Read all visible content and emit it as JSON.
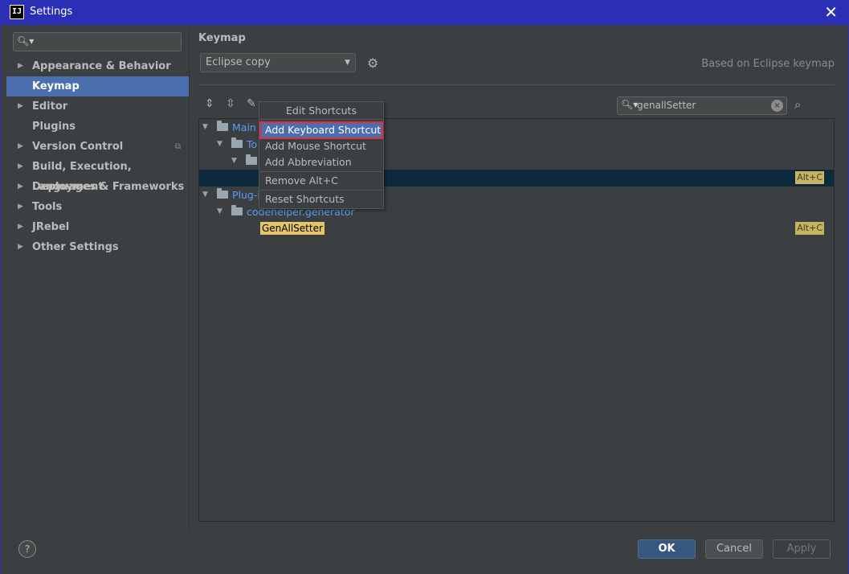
{
  "window": {
    "title": "Settings",
    "app_icon_text": "IJ",
    "close_glyph": "✕"
  },
  "sidebar": {
    "search_placeholder": "",
    "items": [
      {
        "label": "Appearance & Behavior",
        "has_arrow": true
      },
      {
        "label": "Keymap",
        "has_arrow": false,
        "selected": true
      },
      {
        "label": "Editor",
        "has_arrow": true
      },
      {
        "label": "Plugins",
        "has_arrow": false
      },
      {
        "label": "Version Control",
        "has_arrow": true,
        "badge": "copy-icon"
      },
      {
        "label": "Build, Execution, Deployment",
        "has_arrow": true
      },
      {
        "label": "Languages & Frameworks",
        "has_arrow": true
      },
      {
        "label": "Tools",
        "has_arrow": true
      },
      {
        "label": "JRebel",
        "has_arrow": true
      },
      {
        "label": "Other Settings",
        "has_arrow": true
      }
    ]
  },
  "content": {
    "heading": "Keymap",
    "keymap_combo_value": "Eclipse copy",
    "based_on": "Based on Eclipse keymap",
    "search_value": "genallSetter"
  },
  "tree": {
    "rows": [
      {
        "label": "Main",
        "level": 0
      },
      {
        "label": "To",
        "level": 1
      },
      {
        "label": "",
        "level": 2
      },
      {
        "label": "",
        "level": 3,
        "shortcut": "Alt+C"
      },
      {
        "label": "Plug-i",
        "level": 0
      },
      {
        "label": "codehelper.generator",
        "level": 1
      },
      {
        "label": "GenAllSetter",
        "level": 2,
        "shortcut": "Alt+C"
      }
    ]
  },
  "context_menu": {
    "title": "Edit Shortcuts",
    "items": [
      {
        "label": "Add Keyboard Shortcut",
        "active": true
      },
      {
        "label": "Add Mouse Shortcut"
      },
      {
        "label": "Add Abbreviation"
      },
      {
        "label": "Remove Alt+C"
      },
      {
        "label": "Reset Shortcuts"
      }
    ]
  },
  "footer": {
    "help": "?",
    "ok": "OK",
    "cancel": "Cancel",
    "apply": "Apply"
  },
  "colors": {
    "titlebar": "#2b2fb5",
    "selection": "#4b6eaf",
    "highlight_outline": "#e52f32",
    "shortcut_badge": "#c9b35f"
  }
}
